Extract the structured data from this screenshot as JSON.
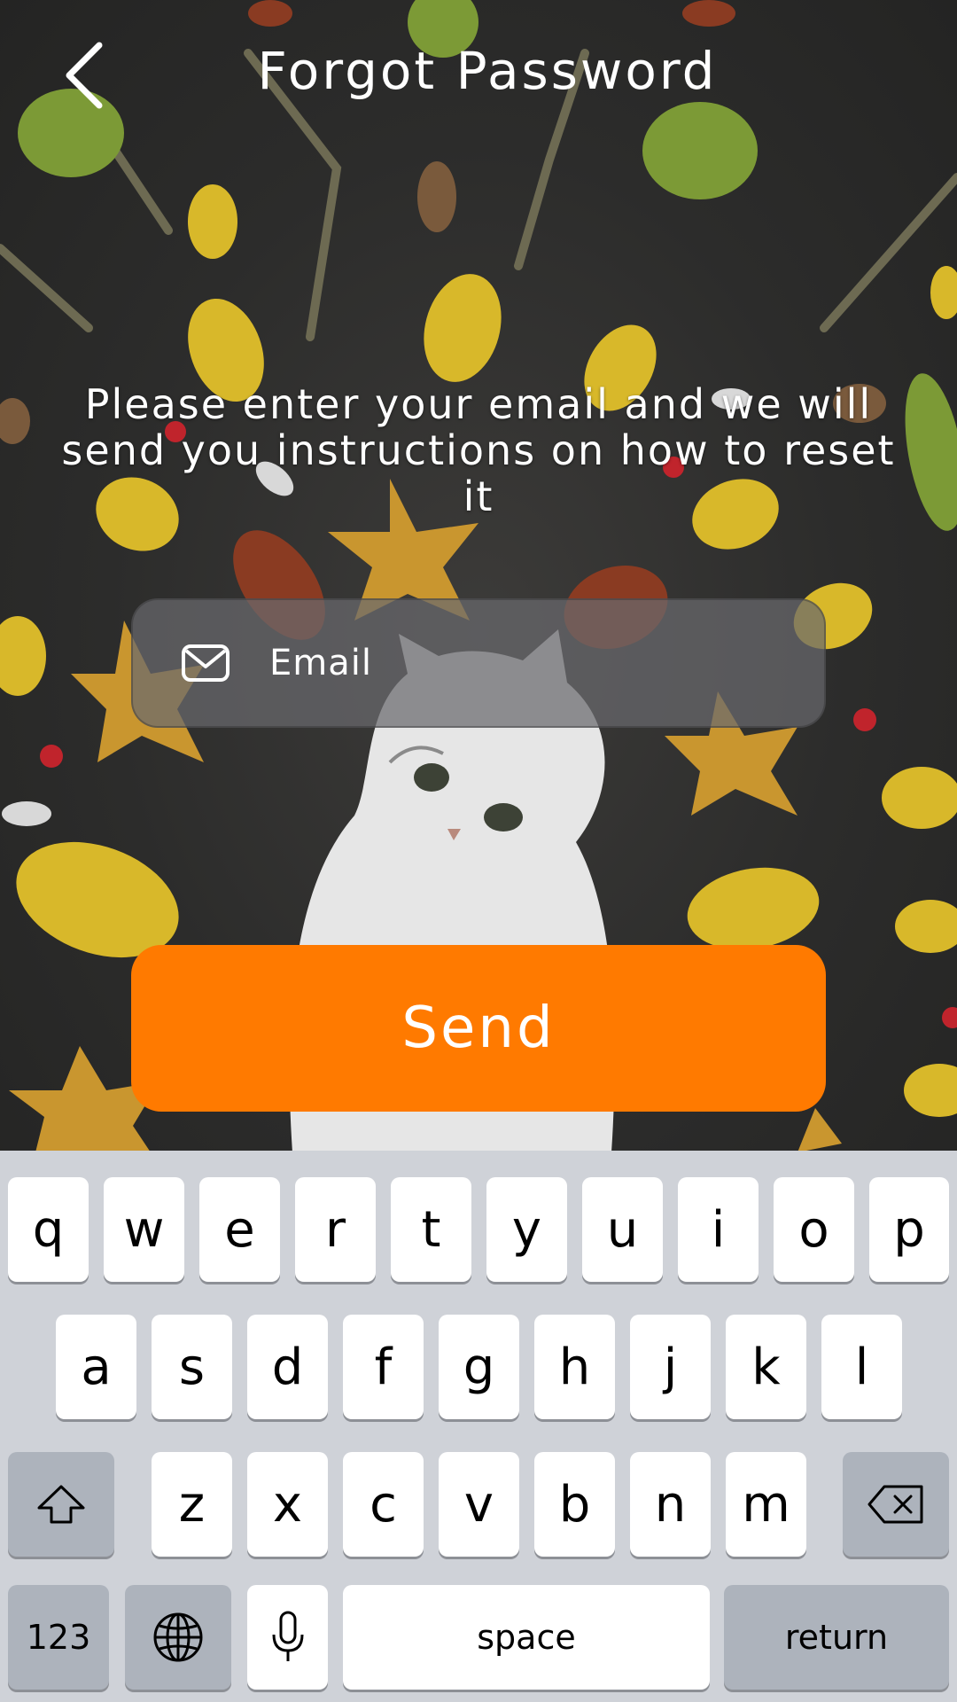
{
  "header": {
    "title": "Forgot Password",
    "back_icon": "chevron-left-icon"
  },
  "instructions": {
    "line1": "Please enter your email and we will",
    "line2": "send you instructions on how to reset it"
  },
  "email_field": {
    "icon": "envelope-icon",
    "placeholder": "Email",
    "value": ""
  },
  "send_button": {
    "label": "Send",
    "color": "#ff7a00"
  },
  "keyboard": {
    "row1": [
      "q",
      "w",
      "e",
      "r",
      "t",
      "y",
      "u",
      "i",
      "o",
      "p"
    ],
    "row2": [
      "a",
      "s",
      "d",
      "f",
      "g",
      "h",
      "j",
      "k",
      "l"
    ],
    "row3": [
      "z",
      "x",
      "c",
      "v",
      "b",
      "n",
      "m"
    ],
    "shift_icon": "shift-arrow-icon",
    "backspace_icon": "backspace-icon",
    "numbers_label": "123",
    "globe_icon": "globe-icon",
    "mic_icon": "microphone-icon",
    "space_label": "space",
    "return_label": "return",
    "background_color": "#cfd2d8"
  }
}
